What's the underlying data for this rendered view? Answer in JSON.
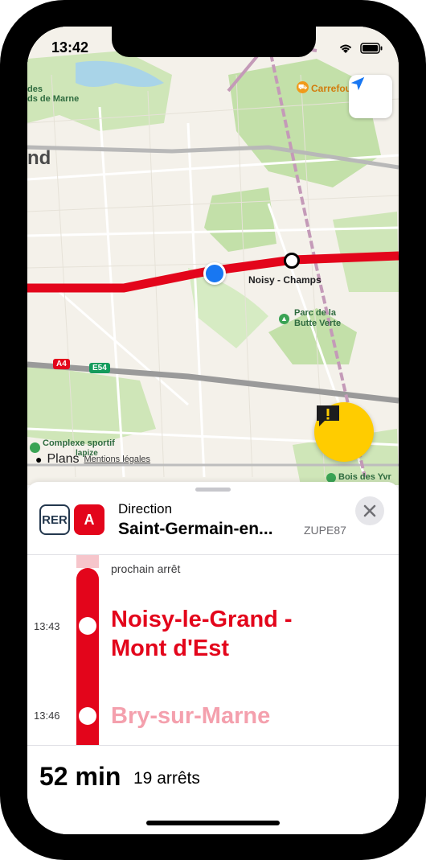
{
  "status": {
    "time": "13:42"
  },
  "map": {
    "labels": {
      "station": "Noisy - Champs",
      "park": "Parc de la Butte Verte",
      "shop": "Carrefour",
      "sport": "Complexe sportif Alain Mimoun - Lapize",
      "sport_line1": "Complexe sportif",
      "sport_line2": "lapize",
      "bois": "Bois des Yvr",
      "marne1": "des",
      "marne2": "ds de Marne",
      "town": "nd",
      "a4": "A4",
      "e54": "E54"
    },
    "attribution": {
      "brand": "Plans",
      "legal": "Mentions légales"
    }
  },
  "sheet": {
    "rer_badge": "RER",
    "line_badge": "A",
    "direction_label": "Direction",
    "direction_value": "Saint-Germain-en...",
    "mission_code": "ZUPE87",
    "next_stop_label": "prochain arrêt",
    "stops": [
      {
        "time": "13:43",
        "name_line1": "Noisy-le-Grand -",
        "name_line2": "Mont d'Est"
      },
      {
        "time": "13:46",
        "name_line1": "Bry-sur-Marne"
      }
    ],
    "summary": {
      "duration": "52 min",
      "stops": "19 arrêts"
    }
  },
  "colors": {
    "line_red": "#e3051b",
    "rer_navy": "#23374d",
    "alert_yellow": "#ffcc00",
    "location_blue": "#1877f2"
  },
  "icons": [
    "wifi-icon",
    "battery-icon",
    "location-arrow-icon",
    "report-alert-icon",
    "close-icon",
    "apple-icon",
    "cart-icon",
    "tree-icon"
  ]
}
